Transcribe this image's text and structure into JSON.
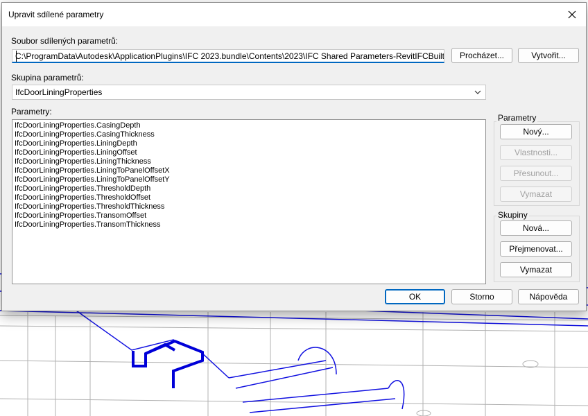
{
  "dialog": {
    "title": "Upravit sdílené parametry",
    "file_label": "Soubor sdílených parametrů:",
    "file_path": "C:\\ProgramData\\Autodesk\\ApplicationPlugins\\IFC 2023.bundle\\Contents\\2023\\IFC Shared Parameters-RevitIFCBuiltIn_ALL.txt",
    "browse_button": "Procházet...",
    "create_button": "Vytvořit...",
    "group_label": "Skupina parametrů:",
    "group_selected": "IfcDoorLiningProperties",
    "params_label": "Parametry:",
    "parameters": [
      "IfcDoorLiningProperties.CasingDepth",
      "IfcDoorLiningProperties.CasingThickness",
      "IfcDoorLiningProperties.LiningDepth",
      "IfcDoorLiningProperties.LiningOffset",
      "IfcDoorLiningProperties.LiningThickness",
      "IfcDoorLiningProperties.LiningToPanelOffsetX",
      "IfcDoorLiningProperties.LiningToPanelOffsetY",
      "IfcDoorLiningProperties.ThresholdDepth",
      "IfcDoorLiningProperties.ThresholdOffset",
      "IfcDoorLiningProperties.ThresholdThickness",
      "IfcDoorLiningProperties.TransomOffset",
      "IfcDoorLiningProperties.TransomThickness"
    ],
    "params_group": {
      "title": "Parametry",
      "new": "Nový...",
      "properties": "Vlastnosti...",
      "move": "Přesunout...",
      "delete": "Vymazat"
    },
    "groups_group": {
      "title": "Skupiny",
      "new": "Nová...",
      "rename": "Přejmenovat...",
      "delete": "Vymazat"
    },
    "ok": "OK",
    "cancel": "Storno",
    "help": "Nápověda"
  },
  "colors": {
    "accent": "#0067c0",
    "model_lines": "#1010e0"
  }
}
